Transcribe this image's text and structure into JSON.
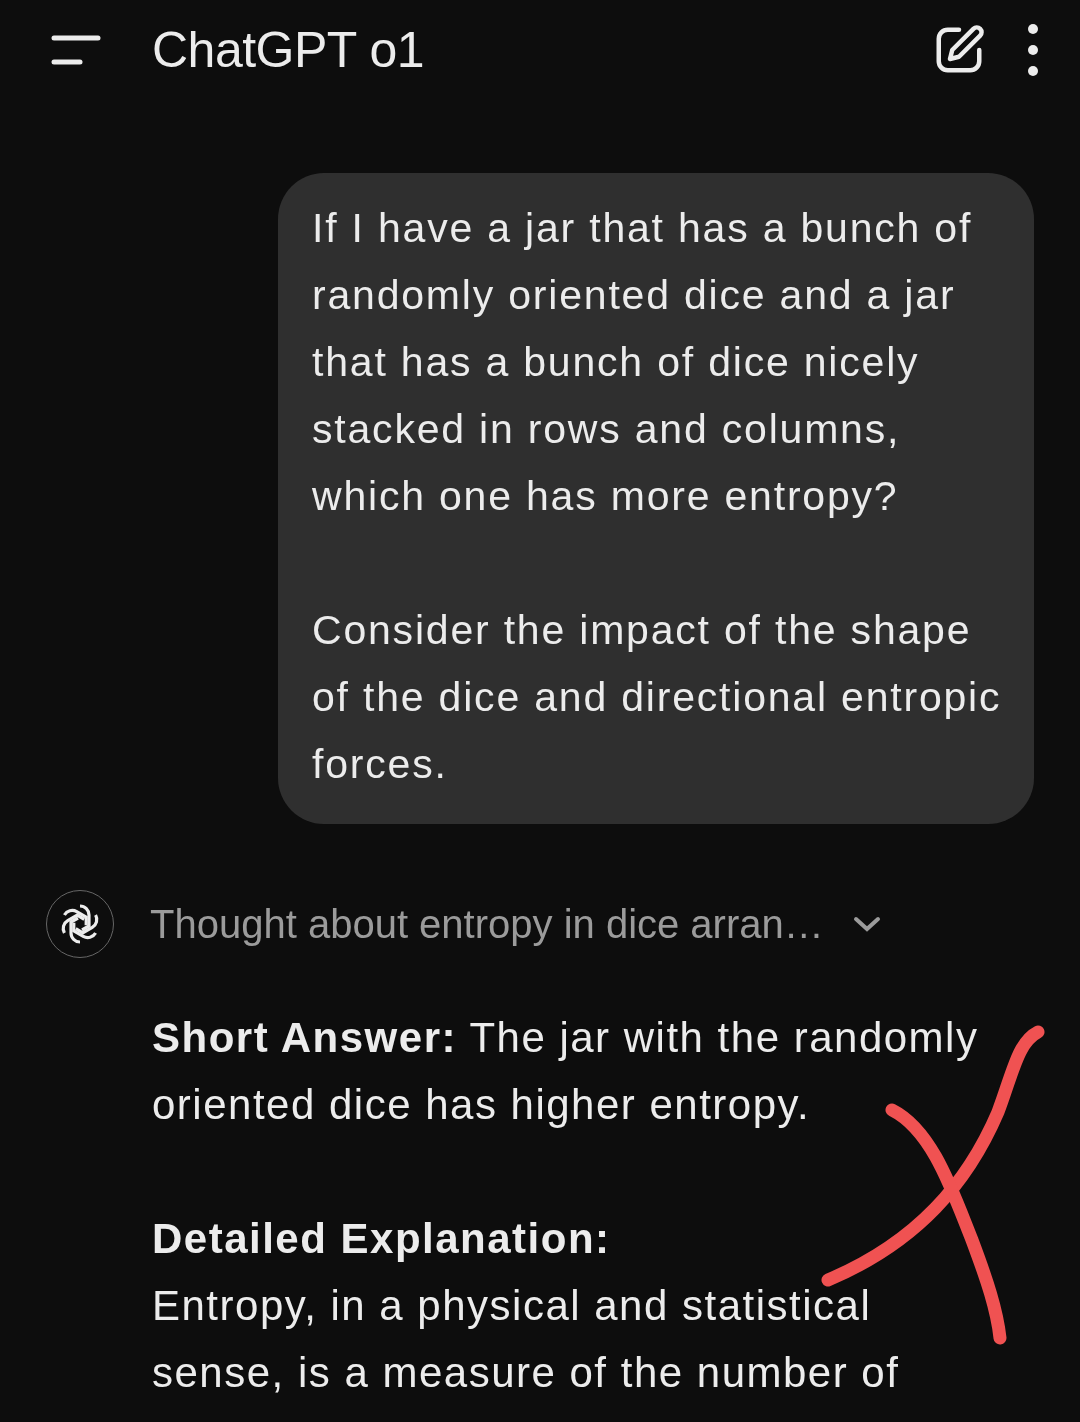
{
  "header": {
    "title": "ChatGPT o1"
  },
  "user_message": {
    "paragraphs": [
      "If I have a jar that has a bunch of randomly oriented dice and a jar that has a bunch of dice nicely stacked in rows and columns, which one has more entropy?",
      "Consider the impact of the shape of the dice and directional entropic forces."
    ]
  },
  "thought": {
    "label": "Thought about entropy in dice arran…",
    "expanded": false
  },
  "answer": [
    {
      "kind": "paragraph",
      "text": "**Short Answer:** The jar with the randomly oriented dice has higher entropy."
    },
    {
      "kind": "heading",
      "text": "Detailed Explanation:"
    },
    {
      "kind": "paragraph",
      "text": "Entropy, in a physical and statistical sense, is a measure of the number of"
    }
  ]
}
